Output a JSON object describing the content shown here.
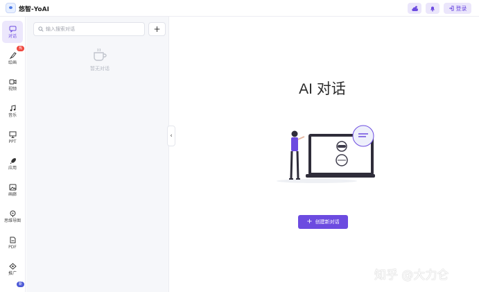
{
  "app": {
    "title": "悠智-YoAI"
  },
  "header": {
    "login_label": "登录"
  },
  "rail": {
    "items": [
      {
        "label": "对话",
        "icon": "chat-icon",
        "active": true
      },
      {
        "label": "绘画",
        "icon": "brush-icon",
        "badge": "热"
      },
      {
        "label": "视频",
        "icon": "video-icon"
      },
      {
        "label": "音乐",
        "icon": "music-icon"
      },
      {
        "label": "PPT",
        "icon": "presentation-icon"
      },
      {
        "label": "应用",
        "icon": "rocket-icon"
      },
      {
        "label": "画廊",
        "icon": "image-icon"
      },
      {
        "label": "思维导图",
        "icon": "mindmap-icon"
      },
      {
        "label": "PDF",
        "icon": "pdf-icon"
      },
      {
        "label": "推广",
        "icon": "share-icon"
      }
    ],
    "bottom_badge": "新"
  },
  "conversation_list": {
    "search_placeholder": "输入搜索对话",
    "empty_text": "暂无对话"
  },
  "main": {
    "title": "AI 对话",
    "create_label": "创建新对话"
  },
  "watermark": "知乎 @大力仑",
  "colors": {
    "accent": "#6c4be0",
    "badge_hot": "#f0463d"
  }
}
